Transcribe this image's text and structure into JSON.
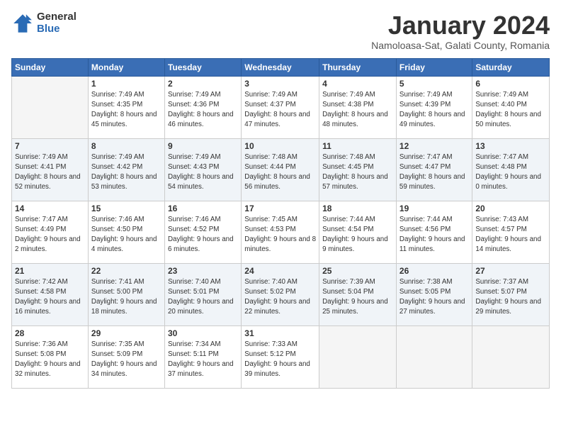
{
  "header": {
    "logo_general": "General",
    "logo_blue": "Blue",
    "month_title": "January 2024",
    "location": "Namoloasa-Sat, Galati County, Romania"
  },
  "days_of_week": [
    "Sunday",
    "Monday",
    "Tuesday",
    "Wednesday",
    "Thursday",
    "Friday",
    "Saturday"
  ],
  "weeks": [
    [
      {
        "day": "",
        "sunrise": "",
        "sunset": "",
        "daylight": ""
      },
      {
        "day": "1",
        "sunrise": "Sunrise: 7:49 AM",
        "sunset": "Sunset: 4:35 PM",
        "daylight": "Daylight: 8 hours and 45 minutes."
      },
      {
        "day": "2",
        "sunrise": "Sunrise: 7:49 AM",
        "sunset": "Sunset: 4:36 PM",
        "daylight": "Daylight: 8 hours and 46 minutes."
      },
      {
        "day": "3",
        "sunrise": "Sunrise: 7:49 AM",
        "sunset": "Sunset: 4:37 PM",
        "daylight": "Daylight: 8 hours and 47 minutes."
      },
      {
        "day": "4",
        "sunrise": "Sunrise: 7:49 AM",
        "sunset": "Sunset: 4:38 PM",
        "daylight": "Daylight: 8 hours and 48 minutes."
      },
      {
        "day": "5",
        "sunrise": "Sunrise: 7:49 AM",
        "sunset": "Sunset: 4:39 PM",
        "daylight": "Daylight: 8 hours and 49 minutes."
      },
      {
        "day": "6",
        "sunrise": "Sunrise: 7:49 AM",
        "sunset": "Sunset: 4:40 PM",
        "daylight": "Daylight: 8 hours and 50 minutes."
      }
    ],
    [
      {
        "day": "7",
        "sunrise": "Sunrise: 7:49 AM",
        "sunset": "Sunset: 4:41 PM",
        "daylight": "Daylight: 8 hours and 52 minutes."
      },
      {
        "day": "8",
        "sunrise": "Sunrise: 7:49 AM",
        "sunset": "Sunset: 4:42 PM",
        "daylight": "Daylight: 8 hours and 53 minutes."
      },
      {
        "day": "9",
        "sunrise": "Sunrise: 7:49 AM",
        "sunset": "Sunset: 4:43 PM",
        "daylight": "Daylight: 8 hours and 54 minutes."
      },
      {
        "day": "10",
        "sunrise": "Sunrise: 7:48 AM",
        "sunset": "Sunset: 4:44 PM",
        "daylight": "Daylight: 8 hours and 56 minutes."
      },
      {
        "day": "11",
        "sunrise": "Sunrise: 7:48 AM",
        "sunset": "Sunset: 4:45 PM",
        "daylight": "Daylight: 8 hours and 57 minutes."
      },
      {
        "day": "12",
        "sunrise": "Sunrise: 7:47 AM",
        "sunset": "Sunset: 4:47 PM",
        "daylight": "Daylight: 8 hours and 59 minutes."
      },
      {
        "day": "13",
        "sunrise": "Sunrise: 7:47 AM",
        "sunset": "Sunset: 4:48 PM",
        "daylight": "Daylight: 9 hours and 0 minutes."
      }
    ],
    [
      {
        "day": "14",
        "sunrise": "Sunrise: 7:47 AM",
        "sunset": "Sunset: 4:49 PM",
        "daylight": "Daylight: 9 hours and 2 minutes."
      },
      {
        "day": "15",
        "sunrise": "Sunrise: 7:46 AM",
        "sunset": "Sunset: 4:50 PM",
        "daylight": "Daylight: 9 hours and 4 minutes."
      },
      {
        "day": "16",
        "sunrise": "Sunrise: 7:46 AM",
        "sunset": "Sunset: 4:52 PM",
        "daylight": "Daylight: 9 hours and 6 minutes."
      },
      {
        "day": "17",
        "sunrise": "Sunrise: 7:45 AM",
        "sunset": "Sunset: 4:53 PM",
        "daylight": "Daylight: 9 hours and 8 minutes."
      },
      {
        "day": "18",
        "sunrise": "Sunrise: 7:44 AM",
        "sunset": "Sunset: 4:54 PM",
        "daylight": "Daylight: 9 hours and 9 minutes."
      },
      {
        "day": "19",
        "sunrise": "Sunrise: 7:44 AM",
        "sunset": "Sunset: 4:56 PM",
        "daylight": "Daylight: 9 hours and 11 minutes."
      },
      {
        "day": "20",
        "sunrise": "Sunrise: 7:43 AM",
        "sunset": "Sunset: 4:57 PM",
        "daylight": "Daylight: 9 hours and 14 minutes."
      }
    ],
    [
      {
        "day": "21",
        "sunrise": "Sunrise: 7:42 AM",
        "sunset": "Sunset: 4:58 PM",
        "daylight": "Daylight: 9 hours and 16 minutes."
      },
      {
        "day": "22",
        "sunrise": "Sunrise: 7:41 AM",
        "sunset": "Sunset: 5:00 PM",
        "daylight": "Daylight: 9 hours and 18 minutes."
      },
      {
        "day": "23",
        "sunrise": "Sunrise: 7:40 AM",
        "sunset": "Sunset: 5:01 PM",
        "daylight": "Daylight: 9 hours and 20 minutes."
      },
      {
        "day": "24",
        "sunrise": "Sunrise: 7:40 AM",
        "sunset": "Sunset: 5:02 PM",
        "daylight": "Daylight: 9 hours and 22 minutes."
      },
      {
        "day": "25",
        "sunrise": "Sunrise: 7:39 AM",
        "sunset": "Sunset: 5:04 PM",
        "daylight": "Daylight: 9 hours and 25 minutes."
      },
      {
        "day": "26",
        "sunrise": "Sunrise: 7:38 AM",
        "sunset": "Sunset: 5:05 PM",
        "daylight": "Daylight: 9 hours and 27 minutes."
      },
      {
        "day": "27",
        "sunrise": "Sunrise: 7:37 AM",
        "sunset": "Sunset: 5:07 PM",
        "daylight": "Daylight: 9 hours and 29 minutes."
      }
    ],
    [
      {
        "day": "28",
        "sunrise": "Sunrise: 7:36 AM",
        "sunset": "Sunset: 5:08 PM",
        "daylight": "Daylight: 9 hours and 32 minutes."
      },
      {
        "day": "29",
        "sunrise": "Sunrise: 7:35 AM",
        "sunset": "Sunset: 5:09 PM",
        "daylight": "Daylight: 9 hours and 34 minutes."
      },
      {
        "day": "30",
        "sunrise": "Sunrise: 7:34 AM",
        "sunset": "Sunset: 5:11 PM",
        "daylight": "Daylight: 9 hours and 37 minutes."
      },
      {
        "day": "31",
        "sunrise": "Sunrise: 7:33 AM",
        "sunset": "Sunset: 5:12 PM",
        "daylight": "Daylight: 9 hours and 39 minutes."
      },
      {
        "day": "",
        "sunrise": "",
        "sunset": "",
        "daylight": ""
      },
      {
        "day": "",
        "sunrise": "",
        "sunset": "",
        "daylight": ""
      },
      {
        "day": "",
        "sunrise": "",
        "sunset": "",
        "daylight": ""
      }
    ]
  ]
}
